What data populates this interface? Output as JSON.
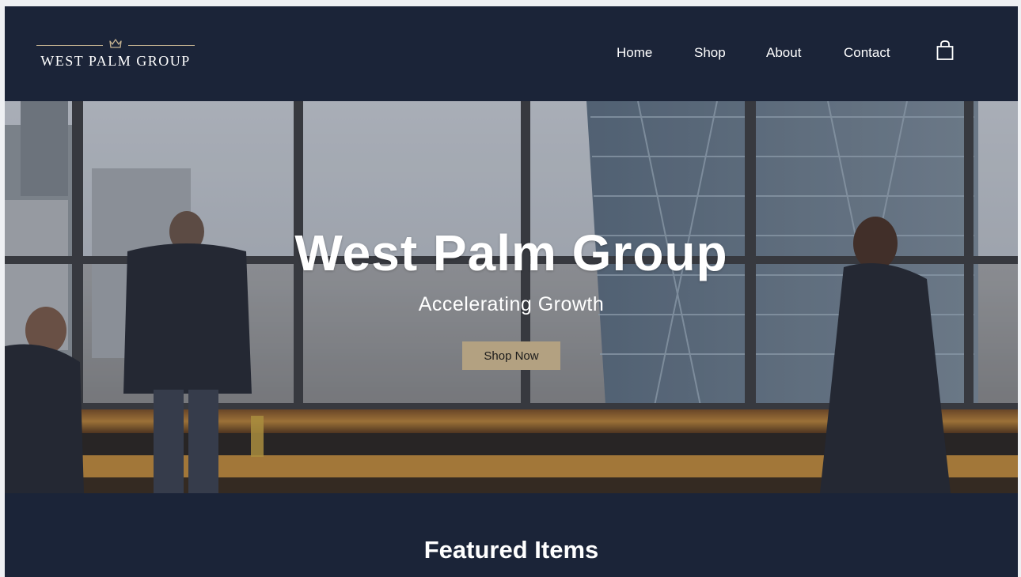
{
  "header": {
    "logo_text": "West Palm Group",
    "nav": [
      {
        "label": "Home"
      },
      {
        "label": "Shop"
      },
      {
        "label": "About"
      },
      {
        "label": "Contact"
      }
    ],
    "cart_icon": "shopping-bag-icon"
  },
  "hero": {
    "title": "West Palm Group",
    "subtitle": "Accelerating Growth",
    "cta_label": "Shop Now"
  },
  "featured": {
    "title": "Featured Items"
  },
  "colors": {
    "navy": "#1b2438",
    "gold": "#b3a181",
    "white": "#ffffff"
  }
}
